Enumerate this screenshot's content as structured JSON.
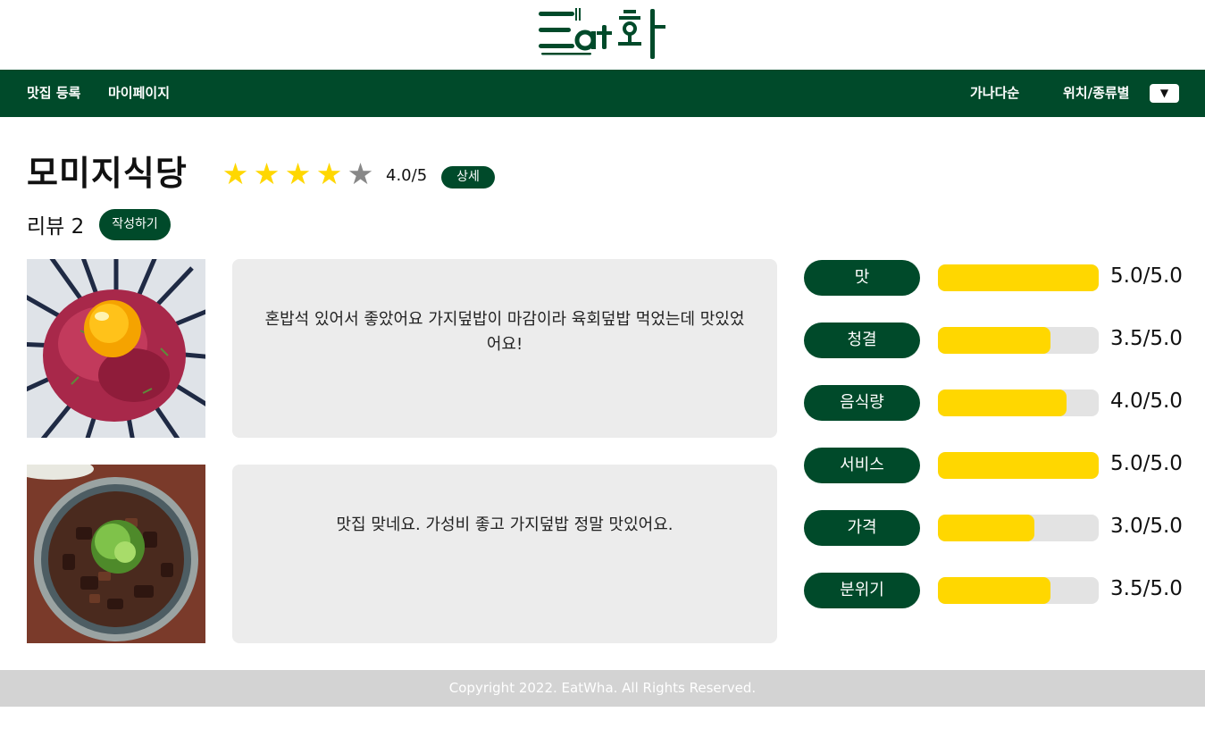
{
  "header": {
    "logo_text": "Eat화"
  },
  "nav": {
    "register": "맛집 등록",
    "mypage": "마이페이지",
    "sort_alpha": "가나다순",
    "sort_location": "위치/종류별",
    "dropdown_arrow": "▼"
  },
  "restaurant": {
    "name": "모미지식당",
    "rating_stars": 4,
    "rating_max": 5,
    "rating_text": "4.0/5",
    "detail_label": "상세"
  },
  "reviews_header": {
    "label": "리뷰 2",
    "write_label": "작성하기"
  },
  "reviews": [
    {
      "text": "혼밥석 있어서 좋았어요 가지덮밥이 마감이라 육회덮밥 먹었는데 맛있었어요!",
      "image": "yukhoe-don-photo"
    },
    {
      "text": "맛집 맞네요. 가성비 좋고 가지덮밥 정말 맛있어요.",
      "image": "eggplant-don-photo"
    }
  ],
  "categories": [
    {
      "label": "맛",
      "score": 5.0,
      "value_text": "5.0/5.0"
    },
    {
      "label": "청결",
      "score": 3.5,
      "value_text": "3.5/5.0"
    },
    {
      "label": "음식량",
      "score": 4.0,
      "value_text": "4.0/5.0"
    },
    {
      "label": "서비스",
      "score": 5.0,
      "value_text": "5.0/5.0"
    },
    {
      "label": "가격",
      "score": 3.0,
      "value_text": "3.0/5.0"
    },
    {
      "label": "분위기",
      "score": 3.5,
      "value_text": "3.5/5.0"
    }
  ],
  "category_max": 5.0,
  "footer": {
    "copyright": "Copyright 2022. EatWha. All Rights Reserved."
  },
  "colors": {
    "brand_green": "#004a2a",
    "star_filled": "#ffd700",
    "star_empty": "#888888",
    "bar_fill": "#ffd700",
    "bar_track": "#e3e3e3",
    "review_bg": "#ececec",
    "footer_bg": "#d3d3d3"
  }
}
